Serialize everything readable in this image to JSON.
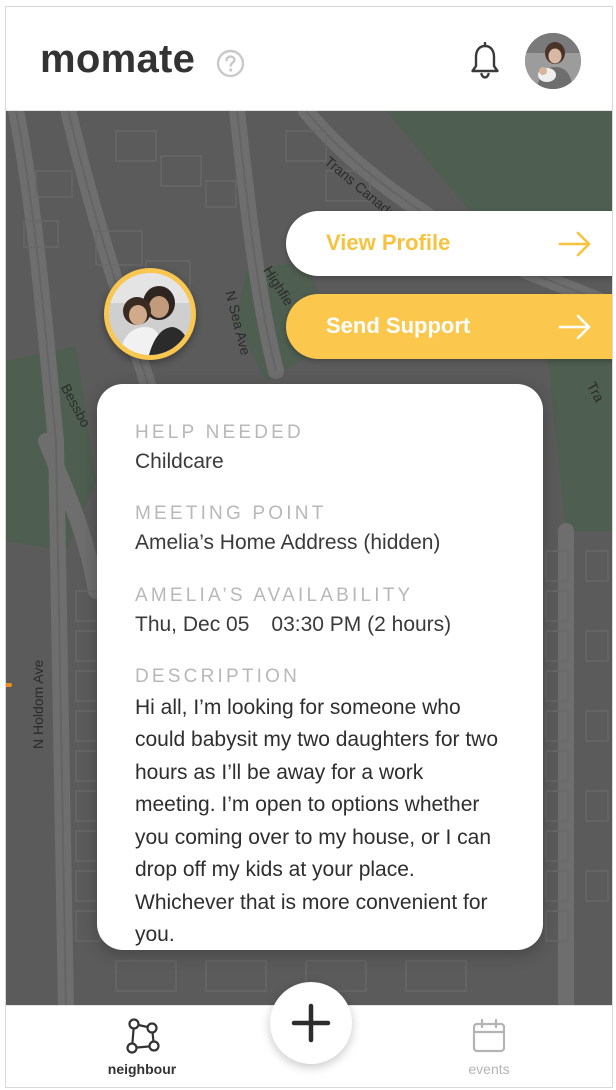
{
  "app": {
    "logo": "momate",
    "icons": {
      "help": "help-circle-icon",
      "notifications": "bell-icon",
      "avatar": "user-avatar-photo"
    }
  },
  "map": {
    "street_labels": [
      "Trans Canada Trail",
      "N Sea Ave",
      "Highfie",
      "Bessbo",
      "N Holdom Ave",
      "Tra"
    ]
  },
  "actions": {
    "view_profile": "View Profile",
    "send_support": "Send Support"
  },
  "request": {
    "help_needed_label": "HELP NEEDED",
    "help_needed_value": "Childcare",
    "meeting_point_label": "MEETING POINT",
    "meeting_point_value": "Amelia’s Home Address (hidden)",
    "availability_label": "AMELIA’S AVAILABILITY",
    "availability_date": "Thu, Dec 05",
    "availability_time": "03:30 PM (2 hours)",
    "description_label": "DESCRIPTION",
    "description_value": "Hi all, I’m looking for someone who could babysit my two daughters for two hours as I’ll be away for a work meeting. I’m open to options whether you coming over to my house, or I can drop off my kids at your place. Whichever that is more convenient for you."
  },
  "nav": {
    "neighbour": "neighbour",
    "events": "events"
  },
  "colors": {
    "accent_yellow": "#fbc84d",
    "map_background": "#5b5b5b",
    "map_park": "#4d5f4f",
    "text_dark": "#333333",
    "label_grey": "#b8b8b8"
  }
}
